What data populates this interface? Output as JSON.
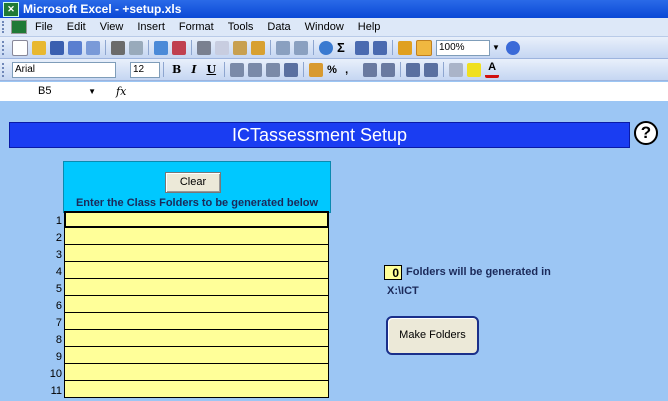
{
  "window": {
    "title": "Microsoft Excel - +setup.xls"
  },
  "menu": [
    "File",
    "Edit",
    "View",
    "Insert",
    "Format",
    "Tools",
    "Data",
    "Window",
    "Help"
  ],
  "toolbar": {
    "zoom": "100%"
  },
  "format_toolbar": {
    "font": "Arial",
    "size": "12",
    "bold": "B",
    "italic": "I",
    "underline": "U"
  },
  "formula_bar": {
    "name_box": "B5",
    "fx_label": "fx"
  },
  "sheet": {
    "header_title": "ICTassessment Setup",
    "help_symbol": "?",
    "clear_button": "Clear",
    "folders_instruction": "Enter the Class Folders to be generated below",
    "row_numbers": [
      "1",
      "2",
      "3",
      "4",
      "5",
      "6",
      "7",
      "8",
      "9",
      "10",
      "11"
    ],
    "folder_count": "0",
    "folder_count_label": "Folders will be generated in",
    "path": "X:\\ICT",
    "make_folders_button": "Make Folders"
  },
  "colors": {
    "background": "#9cc6f4",
    "header": "#1a3df2",
    "cell": "#ffff99",
    "panel": "#00c8ff"
  }
}
